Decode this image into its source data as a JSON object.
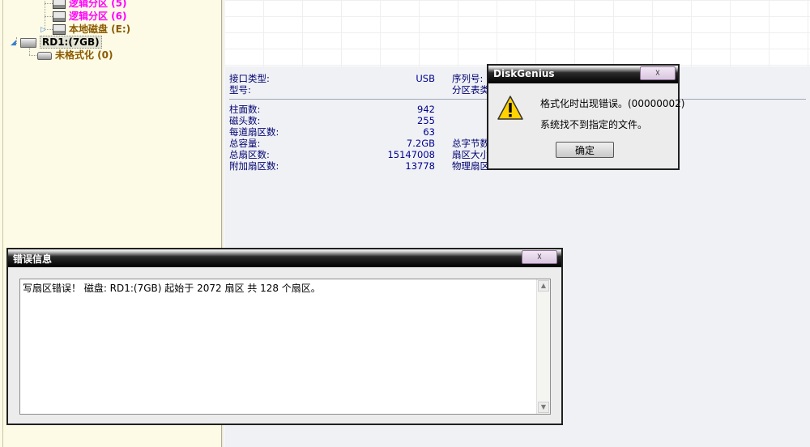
{
  "tree": {
    "items": [
      {
        "label": "逻辑分区 (5)",
        "color": "#ff00ff"
      },
      {
        "label": "逻辑分区 (6)",
        "color": "#ff00ff"
      },
      {
        "label": "本地磁盘 (E:)",
        "color": "#8b5a00"
      },
      {
        "label": "RD1:(7GB)",
        "color": "#000000"
      },
      {
        "label": "未格式化 (0)",
        "color": "#8b5a00"
      }
    ]
  },
  "disk_info": {
    "col1": [
      {
        "label": "接口类型:",
        "value": "USB"
      },
      {
        "label": "型号:",
        "value": ""
      },
      {
        "label": "柱面数:",
        "value": "942"
      },
      {
        "label": "磁头数:",
        "value": "255"
      },
      {
        "label": "每道扇区数:",
        "value": "63"
      },
      {
        "label": "总容量:",
        "value": "7.2GB"
      },
      {
        "label": "总扇区数:",
        "value": "15147008"
      },
      {
        "label": "附加扇区数:",
        "value": "13778"
      }
    ],
    "col2": [
      "序列号:",
      "分区表类",
      "总字节数",
      "扇区大小",
      "物理扇区"
    ]
  },
  "dg_dialog": {
    "title": "DiskGenius",
    "close_label": "☓",
    "message1": "格式化时出现错误。(00000002)",
    "message2": "系统找不到指定的文件。",
    "ok_label": "确定"
  },
  "error_window": {
    "title": "错误信息",
    "close_label": "☓",
    "text": "写扇区错误！ 磁盘: RD1:(7GB) 起始于 2072 扇区 共 128 个扇区。"
  },
  "colors": {
    "magenta": "#ff00ff",
    "brown": "#8b5a00",
    "panel_bg": "#fdfbe5",
    "info_text": "#000070"
  }
}
